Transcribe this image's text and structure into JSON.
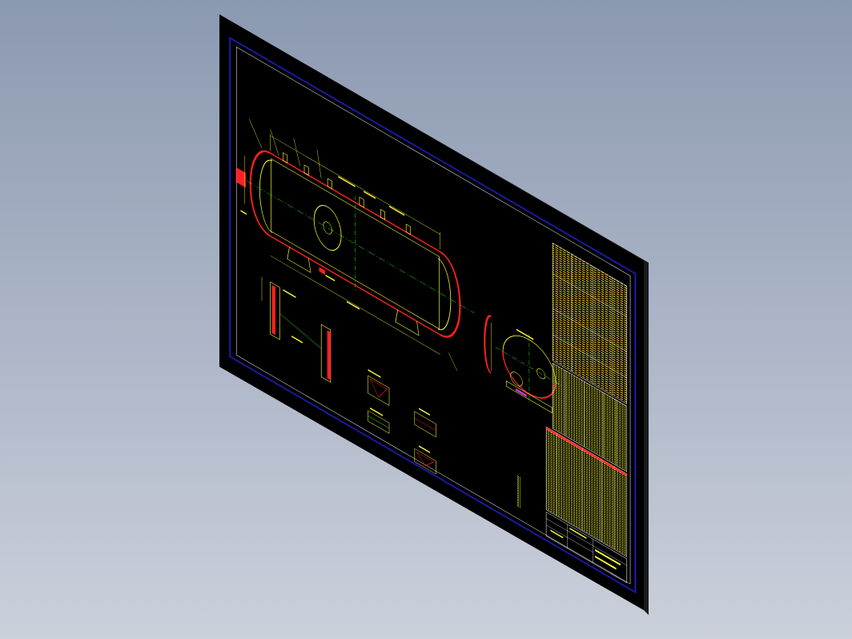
{
  "viewport": {
    "background_top": "#8b99b1",
    "background_bottom": "#cbd0db",
    "view_mode": "isometric"
  },
  "drawing_sheet": {
    "sheet_color": "#000000",
    "frame_color": "#1a1aa8",
    "inner_frame_color": "#ffffff",
    "line_colors": {
      "outline": "#ffff33",
      "shell": "#ff2020",
      "centerline": "#22dd22",
      "dimension": "#ffff33"
    }
  },
  "title_block": {
    "text_color": "#ffff33",
    "grid_color": "#ffffff",
    "accent_color": "#ff3030"
  },
  "notes": {
    "text_color": "#ffff33"
  }
}
